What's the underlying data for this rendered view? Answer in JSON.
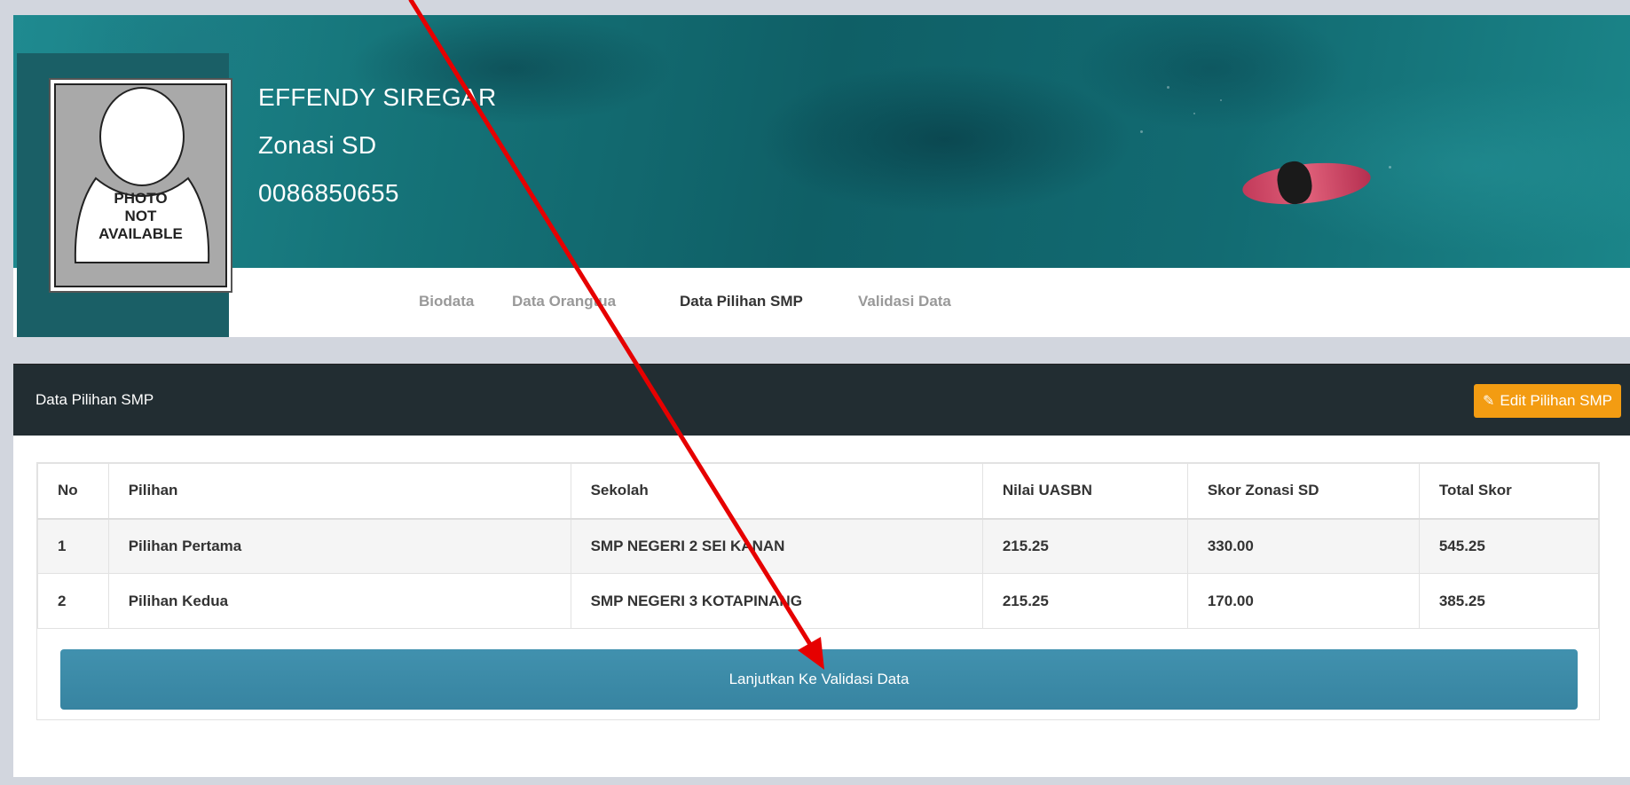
{
  "profile": {
    "name": "EFFENDY SIREGAR",
    "category": "Zonasi SD",
    "nisn": "0086850655",
    "photo_placeholder": [
      "PHOTO",
      "NOT",
      "AVAILABLE"
    ]
  },
  "tabs": [
    {
      "label": "Biodata",
      "active": false
    },
    {
      "label": "Data Orangtua",
      "active": false
    },
    {
      "label": "Data Pilihan SMP",
      "active": true
    },
    {
      "label": "Validasi Data",
      "active": false
    }
  ],
  "panel": {
    "title": "Data Pilihan SMP",
    "edit_button": "Edit Pilihan SMP"
  },
  "table": {
    "headers": [
      "No",
      "Pilihan",
      "Sekolah",
      "Nilai UASBN",
      "Skor Zonasi SD",
      "Total Skor"
    ],
    "rows": [
      [
        "1",
        "Pilihan Pertama",
        "SMP NEGERI 2 SEI KANAN",
        "215.25",
        "330.00",
        "545.25"
      ],
      [
        "2",
        "Pilihan Kedua",
        "SMP NEGERI 3 KOTAPINANG",
        "215.25",
        "170.00",
        "385.25"
      ]
    ]
  },
  "cta_button": "Lanjutkan Ke Validasi Data",
  "colors": {
    "header_dark": "#222d32",
    "edit_button": "#f39c12",
    "cta_button": "#3c8dab",
    "annotation_arrow": "#e60000"
  }
}
